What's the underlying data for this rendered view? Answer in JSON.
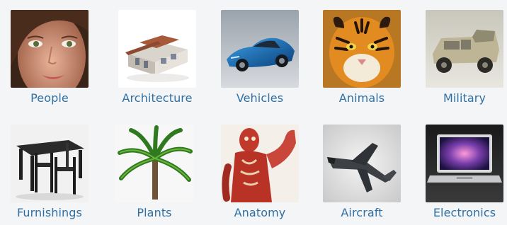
{
  "categories": [
    {
      "label": "People",
      "icon": "person-face-icon"
    },
    {
      "label": "Architecture",
      "icon": "building-icon"
    },
    {
      "label": "Vehicles",
      "icon": "sports-car-icon"
    },
    {
      "label": "Animals",
      "icon": "tiger-icon"
    },
    {
      "label": "Military",
      "icon": "humvee-icon"
    },
    {
      "label": "Furnishings",
      "icon": "table-chairs-icon"
    },
    {
      "label": "Plants",
      "icon": "palm-tree-icon"
    },
    {
      "label": "Anatomy",
      "icon": "muscle-anatomy-icon"
    },
    {
      "label": "Aircraft",
      "icon": "fighter-jet-icon"
    },
    {
      "label": "Electronics",
      "icon": "laptop-icon"
    }
  ],
  "colors": {
    "background": "#f4f5f6",
    "label": "#2f6fa3"
  }
}
